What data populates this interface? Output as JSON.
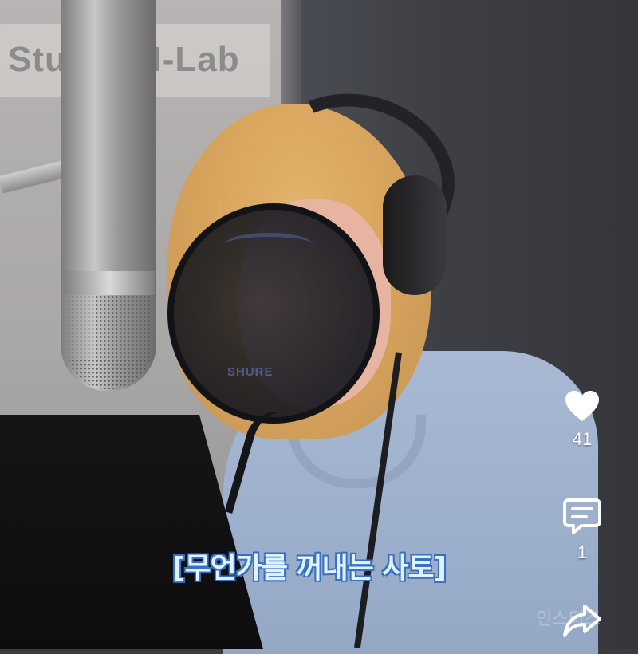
{
  "video": {
    "background_sign_text": "Studio M-Lab",
    "pop_filter_brand": "SHURE",
    "subtitle": "[무언가를 꺼내는 사토]"
  },
  "actions": {
    "like": {
      "icon": "heart-icon",
      "count": "41"
    },
    "comment": {
      "icon": "comment-icon",
      "count": "1"
    },
    "share": {
      "icon": "share-icon"
    }
  },
  "watermark": "인스티즈",
  "colors": {
    "subtitle_fill": "#dff2ff",
    "subtitle_outline": "#3b6fbf",
    "icon_color": "#ffffff"
  }
}
